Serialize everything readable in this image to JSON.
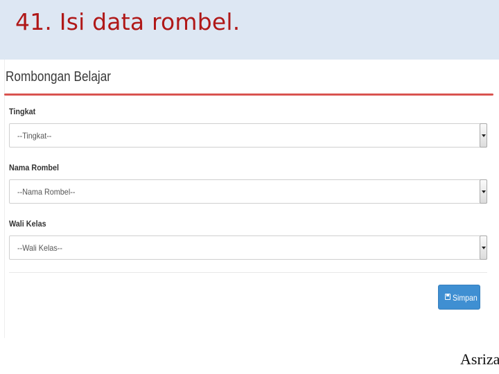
{
  "slide": {
    "title": "41. Isi data rombel.",
    "footer": "Asriza"
  },
  "panel": {
    "title": "Rombongan Belajar",
    "accent_color": "#d9534f"
  },
  "form": {
    "tingkat": {
      "label": "Tingkat",
      "value": "--Tingkat--"
    },
    "nama_rombel": {
      "label": "Nama Rombel",
      "value": "--Nama Rombel--"
    },
    "wali_kelas": {
      "label": "Wali Kelas",
      "value": "--Wali Kelas--"
    }
  },
  "actions": {
    "save_label": "Simpan",
    "save_icon": "floppy-disk-icon",
    "save_color": "#3f8fd2"
  }
}
